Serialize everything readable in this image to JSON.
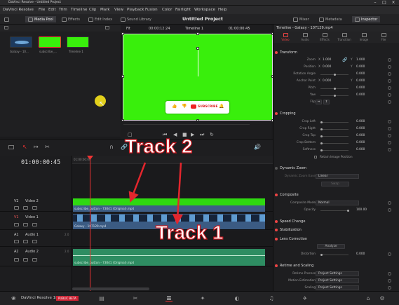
{
  "window": {
    "title": "DaVinci Resolve - Untitled Project",
    "controls": [
      "–",
      "□",
      "×"
    ]
  },
  "menu": [
    "DaVinci Resolve",
    "File",
    "Edit",
    "Trim",
    "Timeline",
    "Clip",
    "Mark",
    "View",
    "Playback",
    "Fusion",
    "Color",
    "Fairlight",
    "Workspace",
    "Help"
  ],
  "toolbar": {
    "media_pool": "Media Pool",
    "effects": "Effects",
    "edit_index": "Edit Index",
    "sound_library": "Sound Library",
    "project_title": "Untitled Project",
    "mixer": "Mixer",
    "metadata": "Metadata",
    "inspector": "Inspector"
  },
  "media_pool": {
    "items": [
      {
        "label": "Galaxy - 10...",
        "color": "#1d3a5e"
      },
      {
        "label": "subscribe_...",
        "color": "#39ef0c"
      },
      {
        "label": "Timeline 1",
        "color": "#39ef0c"
      }
    ]
  },
  "viewer": {
    "zoom": "Fit",
    "timecode_left": "00:00:12:24",
    "timeline_name": "Timeline 1",
    "timecode_right": "01:00:00:45",
    "frame_color": "#39ef0c",
    "card": {
      "like": "👍",
      "dislike": "👎",
      "subscribe": "SUBSCRIBE",
      "bell": "🔔"
    }
  },
  "inspector": {
    "header": "Timeline - Galaxy - 107129.mp4",
    "tabs": [
      "Video",
      "Audio",
      "Effects",
      "Transition",
      "Image",
      "File"
    ],
    "transform": {
      "title": "Transform",
      "zoom": {
        "label": "Zoom",
        "x": "1.000",
        "y": "1.000"
      },
      "position": {
        "label": "Position",
        "x": "0.000",
        "y": "0.000"
      },
      "rotation": {
        "label": "Rotation Angle",
        "value": "0.000"
      },
      "anchor": {
        "label": "Anchor Point",
        "x": "0.000",
        "y": "0.000"
      },
      "pitch": {
        "label": "Pitch",
        "value": "0.000"
      },
      "yaw": {
        "label": "Yaw",
        "value": "0.000"
      },
      "flip": {
        "label": "Flip"
      }
    },
    "cropping": {
      "title": "Cropping",
      "left": {
        "label": "Crop Left",
        "value": "0.000"
      },
      "right": {
        "label": "Crop Right",
        "value": "0.000"
      },
      "top": {
        "label": "Crop Top",
        "value": "0.000"
      },
      "bottom": {
        "label": "Crop Bottom",
        "value": "0.000"
      },
      "softness": {
        "label": "Softness",
        "value": "0.000"
      },
      "retain": "Retain Image Position"
    },
    "dynamic_zoom": {
      "title": "Dynamic Zoom",
      "ease_label": "Dynamic Zoom Ease",
      "ease_value": "Linear",
      "swap": "Swap"
    },
    "composite": {
      "title": "Composite",
      "mode_label": "Composite Mode",
      "mode_value": "Normal",
      "opacity_label": "Opacity",
      "opacity_value": "100.00"
    },
    "speed_change": {
      "title": "Speed Change"
    },
    "stabilization": {
      "title": "Stabilization"
    },
    "lens": {
      "title": "Lens Correction",
      "analyze": "Analyze",
      "distortion_label": "Distortion",
      "distortion_value": "0.000"
    },
    "retime": {
      "title": "Retime and Scaling",
      "process_label": "Retime Process",
      "process_value": "Project Settings",
      "motion_label": "Motion Estimation",
      "motion_value": "Project Settings",
      "scaling_label": "Scaling",
      "scaling_value": "Project Settings"
    }
  },
  "timeline": {
    "timecode": "01:00:00:45",
    "ruler_start": "01:00:00:00",
    "tracks": {
      "v2": {
        "id": "V2",
        "name": "Video 2",
        "clip": "subscribe_button - 73041 (Original).mp4"
      },
      "v1": {
        "id": "V1",
        "name": "Video 1",
        "clip": "Galaxy - 107129.mp4"
      },
      "a1": {
        "id": "A1",
        "name": "Audio 1",
        "level": "2.0"
      },
      "a2": {
        "id": "A2",
        "name": "Audio 2",
        "level": "2.0",
        "clip": "subscribe_button - 73041 (Original).mp4"
      }
    },
    "annotations": {
      "track2": "Track 2",
      "track1": "Track 1"
    }
  },
  "bottom": {
    "app": "DaVinci Resolve 18",
    "badge": "PUBLIC BETA"
  }
}
